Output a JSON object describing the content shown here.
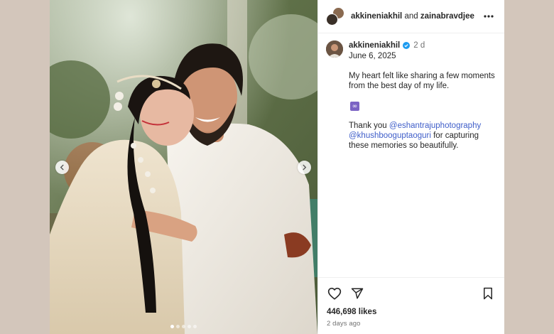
{
  "post": {
    "header": {
      "username": "akkineniakhil",
      "conjunction": "and",
      "collaborator": "zainabravdjee",
      "more_icon": "more-horizontal-icon"
    },
    "caption": {
      "username": "akkineniakhil",
      "verified": true,
      "age": "2 d",
      "date": "June 6, 2025",
      "text_line1": "My heart felt like sharing a few moments from the best day of my life.",
      "emoji": "∞",
      "thanks_prefix": "Thank you",
      "mention1": "@eshantrajuphotography",
      "mention2": "@khushbooguptaoguri",
      "thanks_suffix": "for capturing these memories so beautifully."
    },
    "media": {
      "carousel_total": 5,
      "carousel_active": 1,
      "prev_icon": "chevron-left-icon",
      "next_icon": "chevron-right-icon"
    },
    "actions": {
      "like_icon": "heart-icon",
      "share_icon": "send-icon",
      "save_icon": "bookmark-icon",
      "likes": "446,698 likes",
      "age": "2 days ago"
    },
    "colors": {
      "background": "#d3c6bb",
      "link": "#3f5ec9",
      "verified": "#1d9bf0",
      "text": "#262626",
      "secondary": "#737373"
    }
  }
}
